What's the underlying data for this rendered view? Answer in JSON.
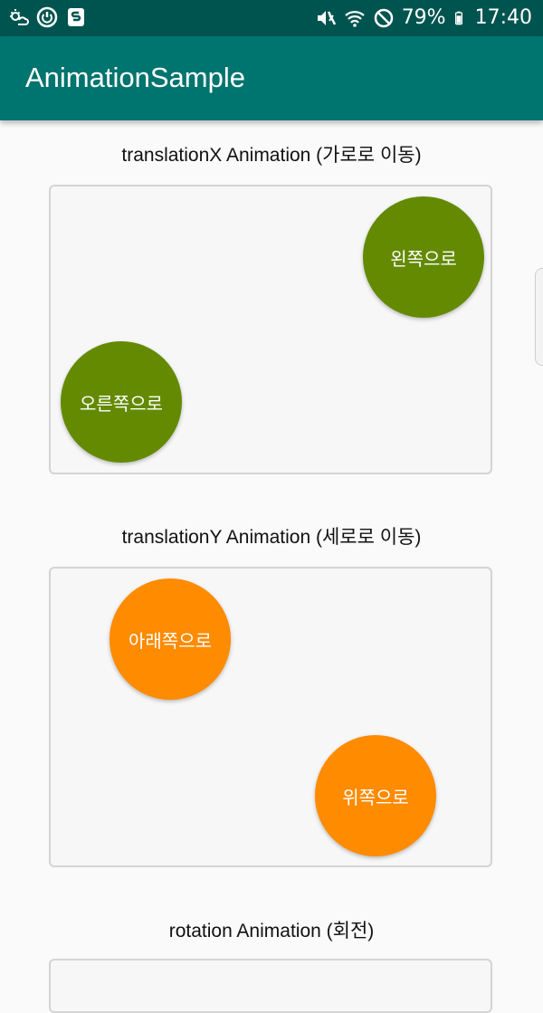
{
  "status_bar": {
    "battery_percent": "79%",
    "time": "17:40",
    "icons": [
      "weather-icon",
      "power-icon",
      "s-app-icon",
      "mute-icon",
      "wifi-icon",
      "no-disturb-icon",
      "battery-icon"
    ]
  },
  "app_bar": {
    "title": "AnimationSample"
  },
  "sections": {
    "translation_x": {
      "title": "translationX Animation (가로로 이동)",
      "left_button": "왼쪽으로",
      "right_button": "오른쪽으로"
    },
    "translation_y": {
      "title": "translationY Animation (세로로 이동)",
      "down_button": "아래쪽으로",
      "up_button": "위쪽으로"
    },
    "rotation": {
      "title": "rotation Animation (회전)"
    }
  },
  "colors": {
    "status_bar": "#00544f",
    "app_bar": "#00746e",
    "green_circle": "#638a00",
    "orange_circle": "#ff8b00",
    "background": "#fafafa"
  }
}
